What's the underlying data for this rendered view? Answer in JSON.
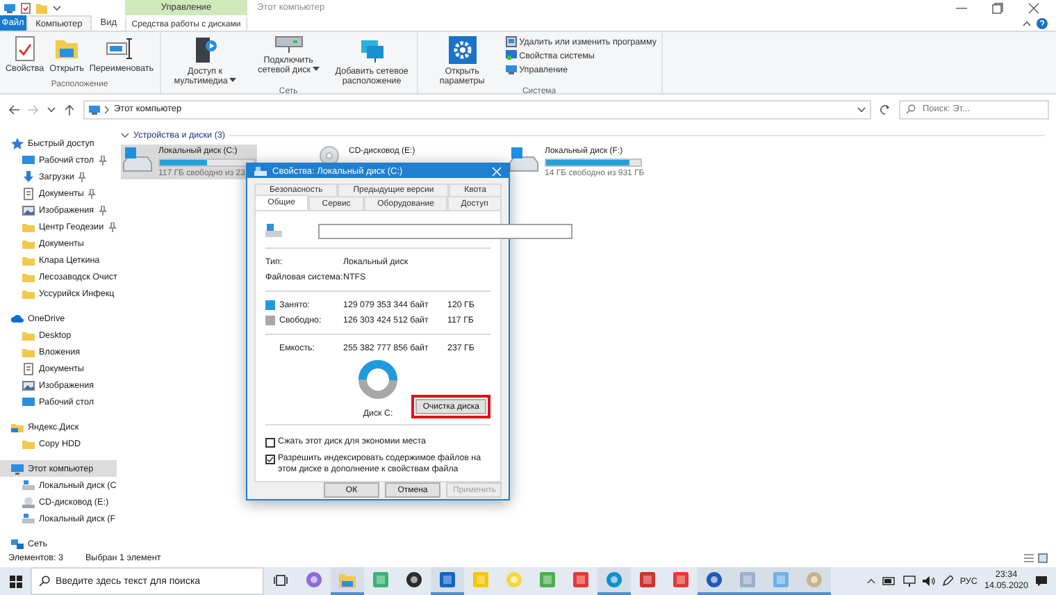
{
  "window": {
    "title": "Этот компьютер",
    "context_header": "Управление"
  },
  "tabs": [
    {
      "label": "Файл",
      "kind": "file",
      "selected": false
    },
    {
      "label": "Компьютер",
      "kind": "normal",
      "selected": true
    },
    {
      "label": "Вид",
      "kind": "normal",
      "selected": false
    },
    {
      "label": "Средства работы с дисками",
      "kind": "context",
      "selected": false
    }
  ],
  "ribbon": {
    "groups": [
      {
        "label": "Расположение",
        "buttons": [
          {
            "label": "Свойства",
            "kind": "large",
            "dropdown": false
          },
          {
            "label": "Открыть",
            "kind": "large",
            "dropdown": false
          },
          {
            "label": "Переименовать",
            "kind": "large",
            "dropdown": false
          }
        ]
      },
      {
        "label": "Сеть",
        "buttons": [
          {
            "label": "Доступ к мультимедиа",
            "kind": "large",
            "dropdown": true
          },
          {
            "label": "Подключить сетевой диск",
            "kind": "large",
            "dropdown": true
          },
          {
            "label": "Добавить сетевое расположение",
            "kind": "large",
            "dropdown": false
          }
        ]
      },
      {
        "label": "Система",
        "buttons": [
          {
            "label": "Открыть параметры",
            "kind": "large",
            "dropdown": false
          },
          {
            "label": "Удалить или изменить программу",
            "kind": "small",
            "dropdown": false
          },
          {
            "label": "Свойства системы",
            "kind": "small",
            "dropdown": false
          },
          {
            "label": "Управление",
            "kind": "small",
            "dropdown": false
          }
        ]
      }
    ]
  },
  "address": {
    "path": "Этот компьютер",
    "search_placeholder": "Поиск: Эт..."
  },
  "sidebar": {
    "items": [
      {
        "label": "Быстрый доступ",
        "kind": "star",
        "selected": false,
        "children": [
          {
            "label": "Рабочий стол",
            "kind": "desktop",
            "selected": false,
            "pinned": true
          },
          {
            "label": "Загрузки",
            "kind": "download",
            "selected": false,
            "pinned": true
          },
          {
            "label": "Документы",
            "kind": "docs",
            "selected": false,
            "pinned": true
          },
          {
            "label": "Изображения",
            "kind": "images",
            "selected": false,
            "pinned": true
          },
          {
            "label": "Центр Геодезии",
            "kind": "folder",
            "selected": false,
            "pinned": true
          },
          {
            "label": "Документы",
            "kind": "folder",
            "selected": false,
            "pinned": false
          },
          {
            "label": "Клара Цеткина",
            "kind": "folder",
            "selected": false,
            "pinned": false
          },
          {
            "label": "Лесозаводск Очист",
            "kind": "folder",
            "selected": false,
            "pinned": false
          },
          {
            "label": "Уссурийск Инфекц",
            "kind": "folder",
            "selected": false,
            "pinned": false
          }
        ]
      },
      {
        "label": "OneDrive",
        "kind": "cloud",
        "selected": false,
        "children": [
          {
            "label": "Desktop",
            "kind": "folder",
            "selected": false
          },
          {
            "label": "Вложения",
            "kind": "folder",
            "selected": false
          },
          {
            "label": "Документы",
            "kind": "docs",
            "selected": false
          },
          {
            "label": "Изображения",
            "kind": "images",
            "selected": false
          },
          {
            "label": "Рабочий стол",
            "kind": "desktop",
            "selected": false
          }
        ]
      },
      {
        "label": "Яндекс.Диск",
        "kind": "yadisk",
        "selected": false,
        "children": [
          {
            "label": "Copy HDD",
            "kind": "folder",
            "selected": false
          }
        ]
      },
      {
        "label": "Этот компьютер",
        "kind": "pc",
        "selected": true,
        "children": [
          {
            "label": "Локальный диск (С",
            "kind": "drive",
            "selected": false
          },
          {
            "label": "CD-дисковод (E:)",
            "kind": "cd",
            "selected": false
          },
          {
            "label": "Локальный диск (F",
            "kind": "drive",
            "selected": false
          }
        ]
      },
      {
        "label": "Сеть",
        "kind": "network",
        "selected": false
      }
    ]
  },
  "content": {
    "section": "Устройства и диски (3)",
    "expanded": true,
    "drives": [
      {
        "name": "Локальный диск (C:)",
        "kind": "hdd",
        "selected": true,
        "level": 0.5,
        "free": "117 ГБ свободно из 23"
      },
      {
        "name": "CD-дисковод (E:)",
        "kind": "cd",
        "selected": false
      },
      {
        "name": "Локальный диск (F:)",
        "kind": "hdd",
        "selected": false,
        "level": 0.88,
        "free": "14 ГБ свободно из 931 ГБ"
      }
    ]
  },
  "dialog": {
    "title": "Свойства: Локальный диск (C:)",
    "tab_rows": [
      {
        "tabs": [
          {
            "label": "Безопасность",
            "selected": false
          },
          {
            "label": "Предыдущие версии",
            "selected": false
          },
          {
            "label": "Квота",
            "selected": false
          }
        ]
      },
      {
        "tabs": [
          {
            "label": "Общие",
            "selected": true
          },
          {
            "label": "Сервис",
            "selected": false
          },
          {
            "label": "Оборудование",
            "selected": false
          },
          {
            "label": "Доступ",
            "selected": false
          }
        ]
      }
    ],
    "info": [
      {
        "label": "Тип:",
        "value": "Локальный диск"
      },
      {
        "label": "Файловая система:",
        "value": "NTFS"
      }
    ],
    "space": [
      {
        "label": "Занято:",
        "bytes": "129 079 353 344 байт",
        "size": "120 ГБ",
        "color": "#1e9ae0"
      },
      {
        "label": "Свободно:",
        "bytes": "126 303 424 512 байт",
        "size": "117 ГБ",
        "color": "#a8a8a8"
      }
    ],
    "capacity": {
      "label": "Емкость:",
      "bytes": "255 382 777 856 байт",
      "size": "237 ГБ"
    },
    "usage": {
      "level": 0.505
    },
    "disk_label": "Диск С:",
    "cleanup_button": {
      "label": "Очистка диска",
      "highlighted": true
    },
    "options": [
      {
        "label": "Сжать этот диск для экономии места",
        "checked": false
      },
      {
        "label": "Разрешить индексировать содержимое файлов на этом диске в дополнение к свойствам файла",
        "checked": true
      }
    ],
    "buttons": [
      {
        "label": "ОК",
        "disabled": false
      },
      {
        "label": "Отмена",
        "disabled": false
      },
      {
        "label": "Применить",
        "disabled": true
      }
    ]
  },
  "status_bar": {
    "count": "Элементов: 3",
    "selection": "Выбран 1 элемент"
  },
  "taskbar": {
    "search_placeholder": "Введите здесь текст для поиска",
    "apps": [
      {
        "running": false
      },
      {
        "running": true
      },
      {
        "running": false
      },
      {
        "running": false
      },
      {
        "running": true
      },
      {
        "running": false
      },
      {
        "running": false
      },
      {
        "running": false
      },
      {
        "running": false
      },
      {
        "running": true
      },
      {
        "running": false
      },
      {
        "running": false
      },
      {
        "running": true
      },
      {
        "running": true
      },
      {
        "running": true
      },
      {
        "running": true
      }
    ],
    "language": "РУС",
    "time": "23:34",
    "date": "14.05.2020"
  }
}
